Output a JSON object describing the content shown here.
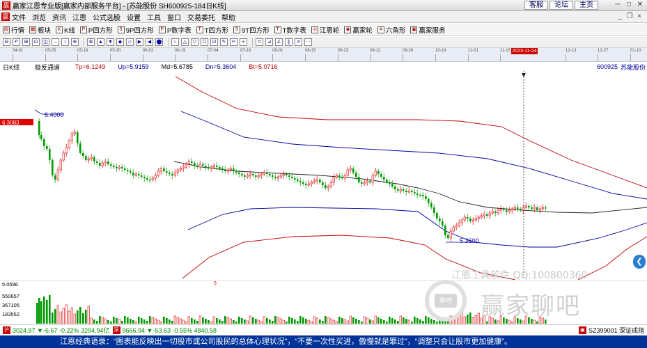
{
  "titlebar": {
    "title": "赢家江恩专业版[赢家内部服务平台] - [苏能股份  SH600925-184日K线]",
    "links": [
      "客服",
      "论坛",
      "主页"
    ]
  },
  "menu": {
    "items": [
      "文件",
      "浏览",
      "资讯",
      "江恩",
      "公式选股",
      "设置",
      "工具",
      "窗口",
      "交易委托",
      "帮助"
    ]
  },
  "toolbar1": {
    "items": [
      "行情",
      "板块",
      "K线",
      "P四方形",
      "9P四方形",
      "P数字表",
      "T四方形",
      "9T四方形",
      "T数字表",
      "江恩轮",
      "赢家轮",
      "六角形",
      "赢家服务"
    ]
  },
  "timeaxis": {
    "ticks": [
      "04-01",
      "05-05",
      "05-18",
      "05-30",
      "06-02",
      "06-19",
      "07-04",
      "07-18",
      "08-01",
      "08-15",
      "08-23",
      "09-12",
      "09-26",
      "10-19",
      "11-01",
      "11-15",
      "2023-11-24",
      "12-13",
      "12-27",
      "01-10"
    ],
    "cursor_date": "2023-11-24"
  },
  "chart_header": {
    "period": "日K线",
    "indicator": "极反通道",
    "tp": "Tp=6.1249",
    "up": "Up=5.9159",
    "md": "Md=5.6785",
    "dn": "Dn=5.3604",
    "bt": "Bt=5.0716",
    "code": "600925",
    "stock_name": "苏能股份"
  },
  "price_labels": {
    "high": "6.4000",
    "low": "5.3600",
    "cursor_price": "6.3083"
  },
  "volume": {
    "max_label": "5.0596",
    "levels": [
      "550657",
      "367105",
      "183552"
    ],
    "marker": "5"
  },
  "watermark": {
    "line1": "江恩工具软件  QQ:100800360",
    "line2": "赢家聊吧"
  },
  "indexbar": {
    "sh": "3024.97 ▼-6.67 -0.22% 3294.94亿",
    "sz": "9666.94 ▼-53.63 -0.55% 4840.58",
    "right": "SZ399001 深证成指"
  },
  "quote": "江恩经典语录：“图表能反映出一切股市或公司股民的总体心理状况”，“不要一次性买进，傲慢就是罪过”，“调整只会让股市更加健康”。",
  "colors": {
    "up_candle": "#e00000",
    "down_candle": "#009900",
    "channel_outer": "#c00000",
    "channel_inner": "#0000a0",
    "mid_line": "#222222",
    "quote_bg": "#00339a"
  }
}
